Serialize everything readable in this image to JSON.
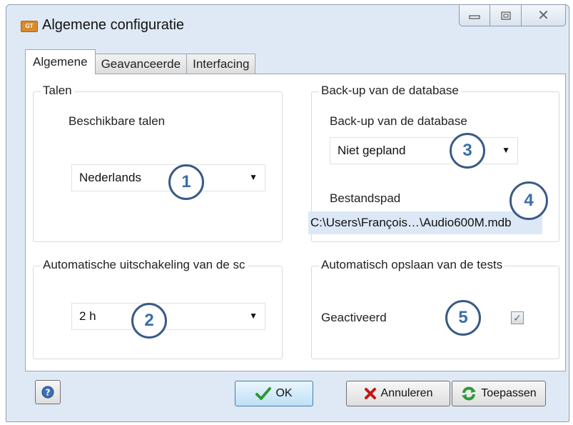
{
  "window": {
    "title": "Algemene configuratie",
    "app_icon_text": "GT",
    "controls": {
      "minimize": "▭",
      "maximize": "▣",
      "close": "✕"
    }
  },
  "tabs": [
    {
      "label": "Algemene",
      "active": true
    },
    {
      "label": "Geavanceerde",
      "active": false
    },
    {
      "label": "Interfacing",
      "active": false
    }
  ],
  "languages": {
    "group_title": "Talen",
    "label": "Beschikbare talen",
    "selected": "Nederlands"
  },
  "auto_shutdown": {
    "group_title": "Automatische uitschakeling van de sc",
    "selected": "2 h"
  },
  "backup": {
    "group_title": "Back-up van de database",
    "label": "Back-up van de database",
    "selected": "Niet gepland",
    "path_label": "Bestandspad",
    "path_value": "C:\\Users\\François…\\Audio600M.mdb"
  },
  "autosave": {
    "group_title": "Automatisch opslaan van de tests",
    "checkbox_label": "Geactiveerd",
    "checked": true
  },
  "callouts": [
    "1",
    "2",
    "3",
    "4",
    "5"
  ],
  "buttons": {
    "ok": "OK",
    "cancel": "Annuleren",
    "apply": "Toepassen"
  },
  "icons": {
    "ok": "check-icon",
    "cancel": "x-icon",
    "apply": "refresh-icon",
    "help": "help-icon"
  },
  "colors": {
    "callout_ring": "#3a5a86",
    "callout_text": "#3a6ea8",
    "path_highlight": "#dce8f6",
    "ok_border": "#3c7fb1"
  }
}
